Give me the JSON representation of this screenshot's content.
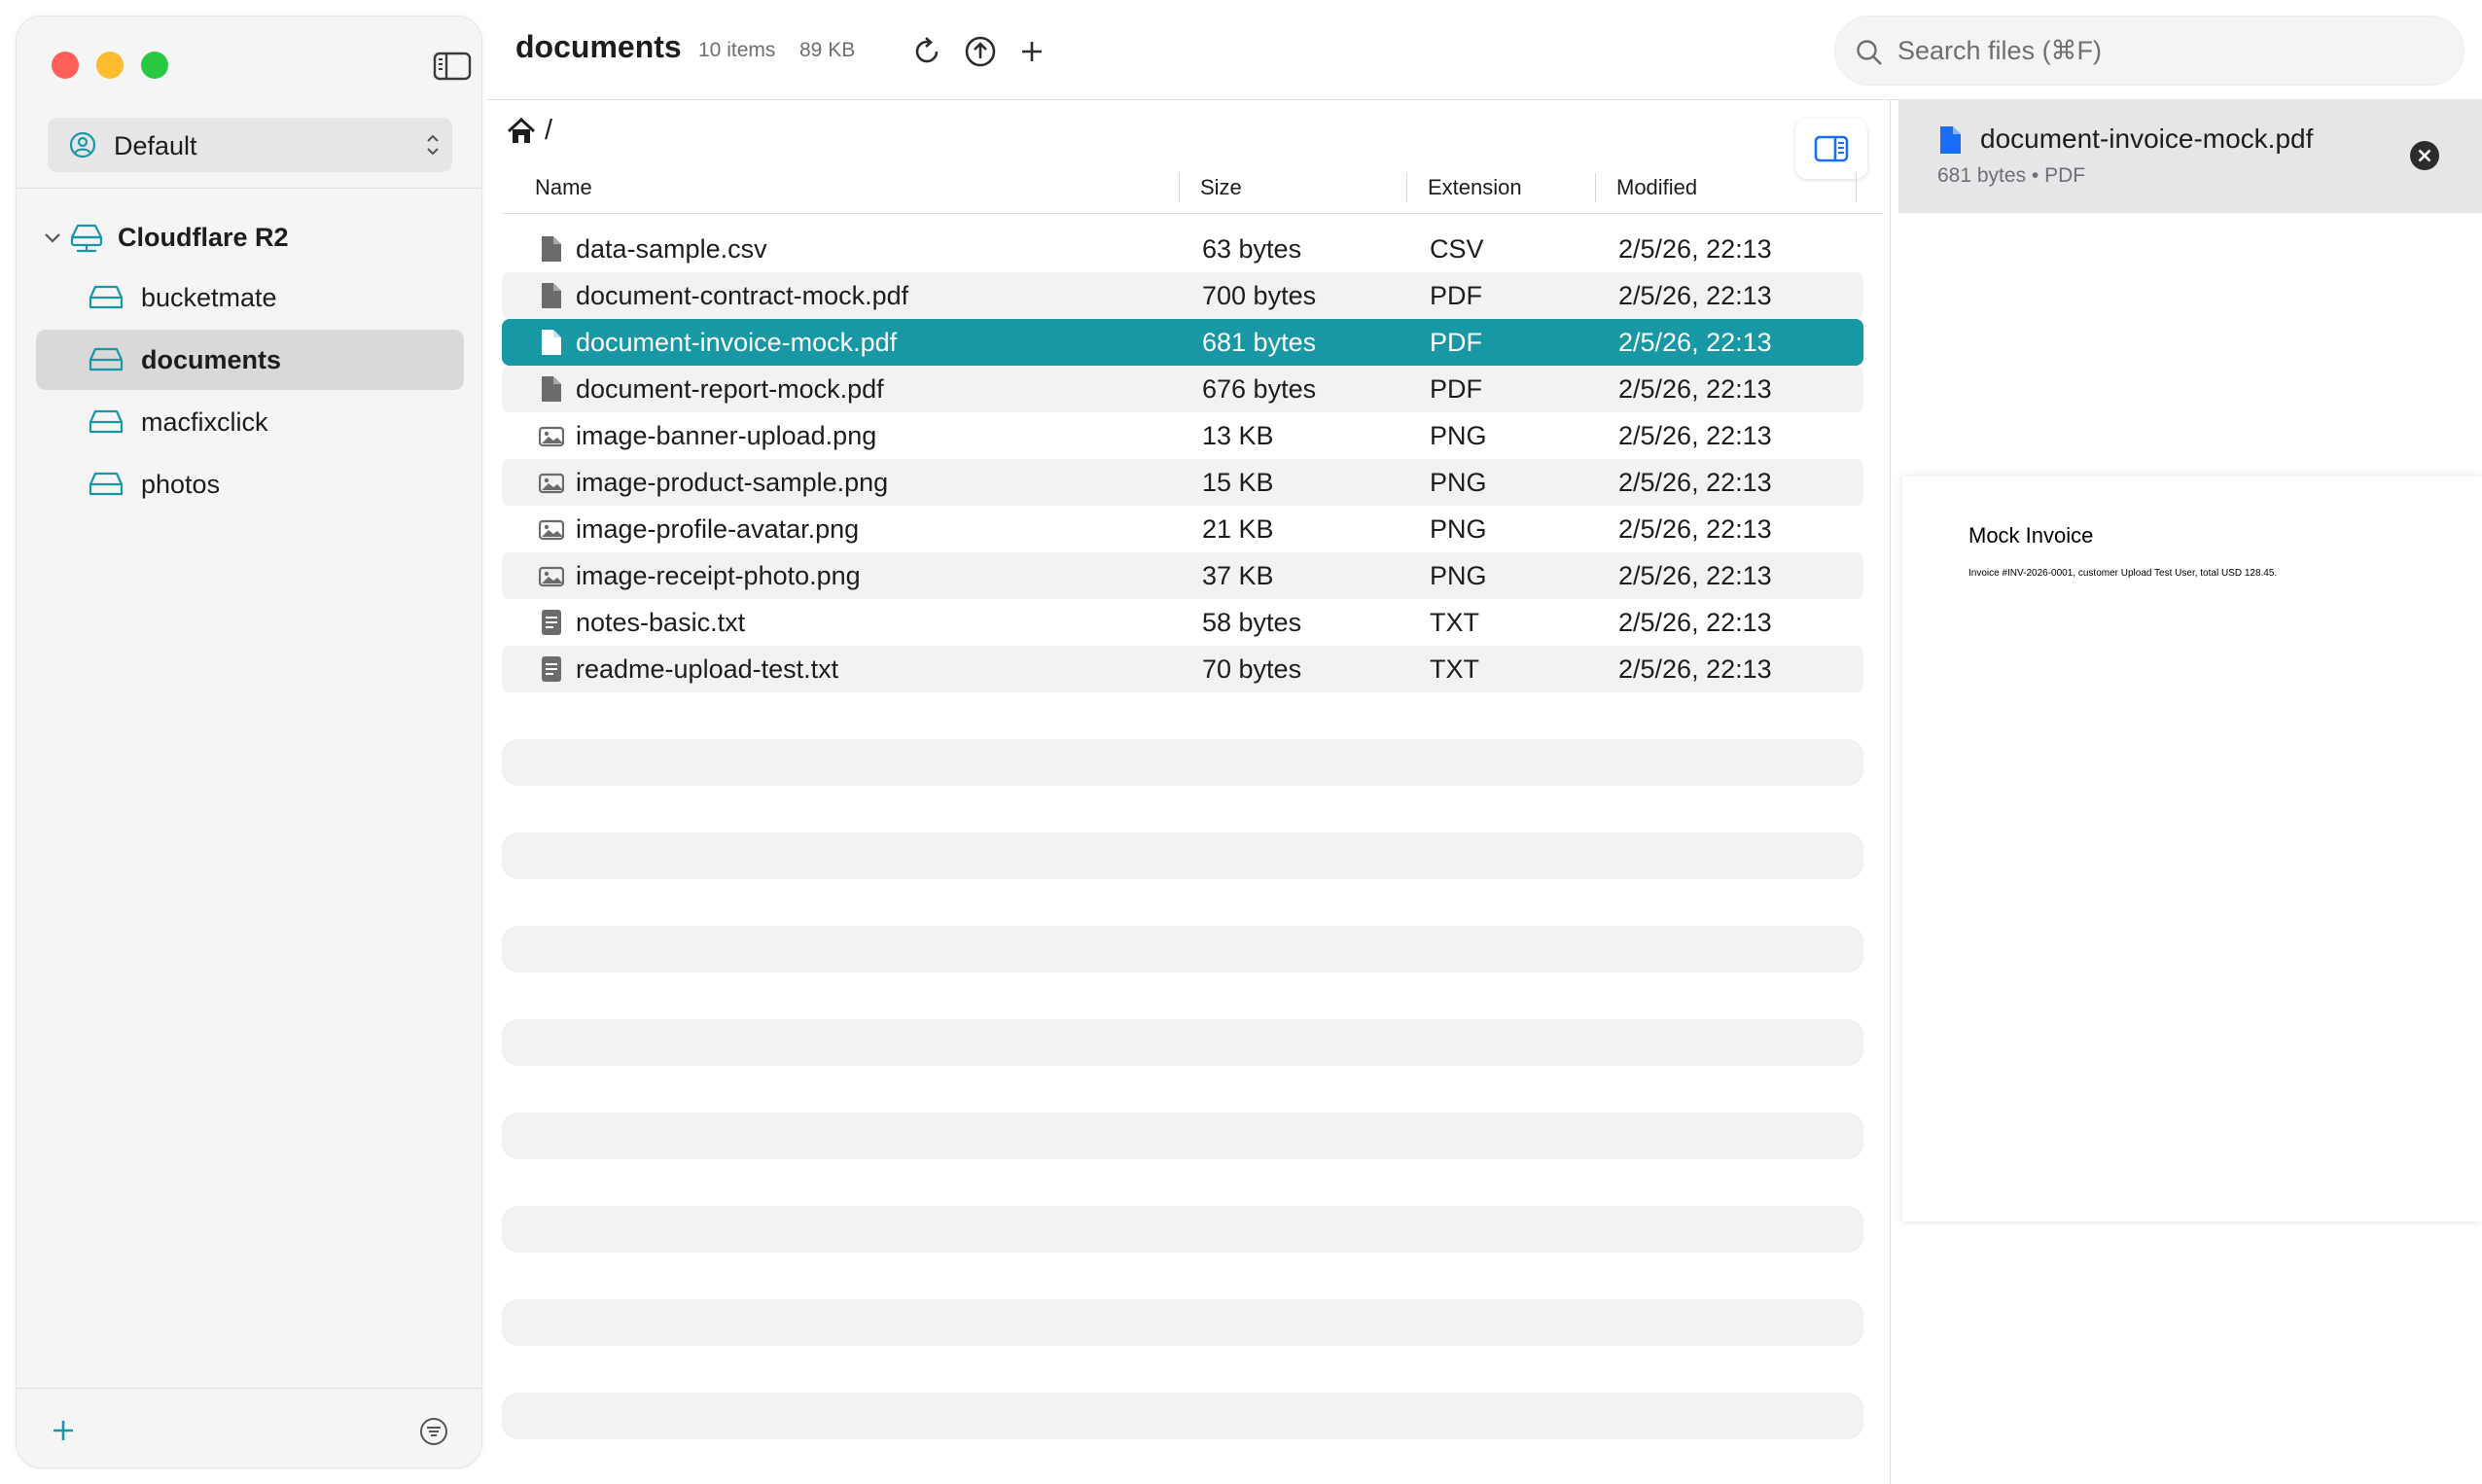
{
  "sidebar": {
    "profile": "Default",
    "provider": "Cloudflare R2",
    "buckets": [
      {
        "label": "bucketmate"
      },
      {
        "label": "documents"
      },
      {
        "label": "macfixclick"
      },
      {
        "label": "photos"
      }
    ],
    "selected_bucket": "documents"
  },
  "toolbar": {
    "title": "documents",
    "item_count": "10 items",
    "total_size": "89 KB"
  },
  "search": {
    "placeholder": "Search files (⌘F)"
  },
  "breadcrumb": {
    "separator": "/"
  },
  "table": {
    "columns": [
      "Name",
      "Size",
      "Extension",
      "Modified"
    ],
    "rows": [
      {
        "name": "data-sample.csv",
        "size": "63 bytes",
        "ext": "CSV",
        "modified": "2/5/26, 22:13",
        "icon": "file-icon"
      },
      {
        "name": "document-contract-mock.pdf",
        "size": "700 bytes",
        "ext": "PDF",
        "modified": "2/5/26, 22:13",
        "icon": "file-icon"
      },
      {
        "name": "document-invoice-mock.pdf",
        "size": "681 bytes",
        "ext": "PDF",
        "modified": "2/5/26, 22:13",
        "icon": "file-icon"
      },
      {
        "name": "document-report-mock.pdf",
        "size": "676 bytes",
        "ext": "PDF",
        "modified": "2/5/26, 22:13",
        "icon": "file-icon"
      },
      {
        "name": "image-banner-upload.png",
        "size": "13 KB",
        "ext": "PNG",
        "modified": "2/5/26, 22:13",
        "icon": "image-icon"
      },
      {
        "name": "image-product-sample.png",
        "size": "15 KB",
        "ext": "PNG",
        "modified": "2/5/26, 22:13",
        "icon": "image-icon"
      },
      {
        "name": "image-profile-avatar.png",
        "size": "21 KB",
        "ext": "PNG",
        "modified": "2/5/26, 22:13",
        "icon": "image-icon"
      },
      {
        "name": "image-receipt-photo.png",
        "size": "37 KB",
        "ext": "PNG",
        "modified": "2/5/26, 22:13",
        "icon": "image-icon"
      },
      {
        "name": "notes-basic.txt",
        "size": "58 bytes",
        "ext": "TXT",
        "modified": "2/5/26, 22:13",
        "icon": "text-file-icon"
      },
      {
        "name": "readme-upload-test.txt",
        "size": "70 bytes",
        "ext": "TXT",
        "modified": "2/5/26, 22:13",
        "icon": "text-file-icon"
      }
    ],
    "selected_index": 2
  },
  "preview": {
    "file_name": "document-invoice-mock.pdf",
    "meta": "681 bytes • PDF",
    "pdf_title": "Mock Invoice",
    "pdf_body": "Invoice #INV-2026-0001, customer Upload Test User, total USD 128.45."
  },
  "colors": {
    "accent": "#1897a5",
    "selection_row": "#1897a5",
    "pdf_icon": "#1a6ef5"
  }
}
